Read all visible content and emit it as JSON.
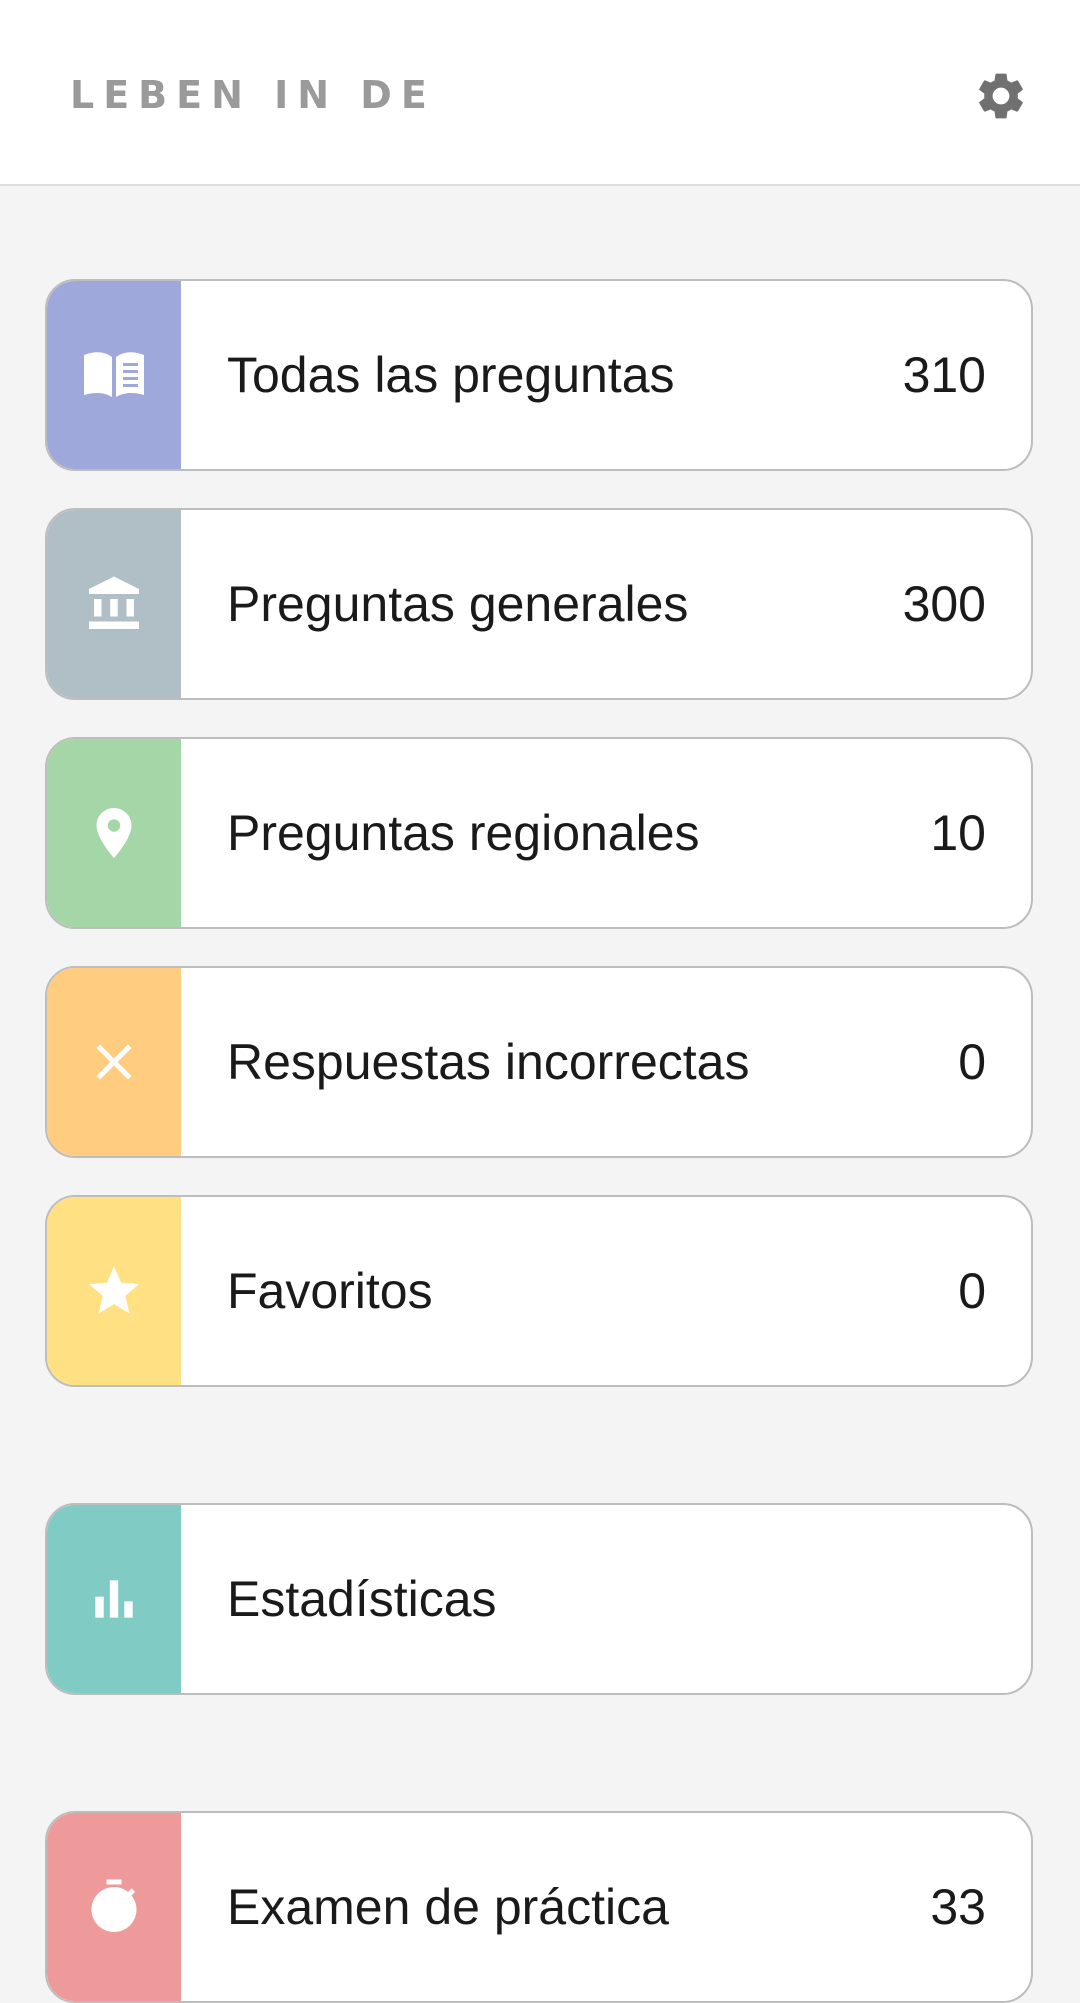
{
  "header": {
    "title": "LEBEN IN DE",
    "settings_icon": "gear-icon"
  },
  "colors": {
    "all_questions": "#9fa8da",
    "general_questions": "#b0bec5",
    "regional_questions": "#a5d6a7",
    "incorrect_answers": "#ffcc80",
    "favorites": "#ffe082",
    "statistics": "#80cbc4",
    "practice_exam": "#ef9a9a"
  },
  "menu": {
    "all_questions": {
      "label": "Todas las preguntas",
      "count": "310",
      "icon": "book-icon"
    },
    "general_questions": {
      "label": "Preguntas generales",
      "count": "300",
      "icon": "bank-icon"
    },
    "regional_questions": {
      "label": "Preguntas regionales",
      "count": "10",
      "icon": "location-pin-icon"
    },
    "incorrect_answers": {
      "label": "Respuestas incorrectas",
      "count": "0",
      "icon": "close-icon"
    },
    "favorites": {
      "label": "Favoritos",
      "count": "0",
      "icon": "star-icon"
    },
    "statistics": {
      "label": "Estadísticas",
      "icon": "bar-chart-icon"
    },
    "practice_exam": {
      "label": "Examen de práctica",
      "count": "33",
      "icon": "stopwatch-icon"
    }
  }
}
